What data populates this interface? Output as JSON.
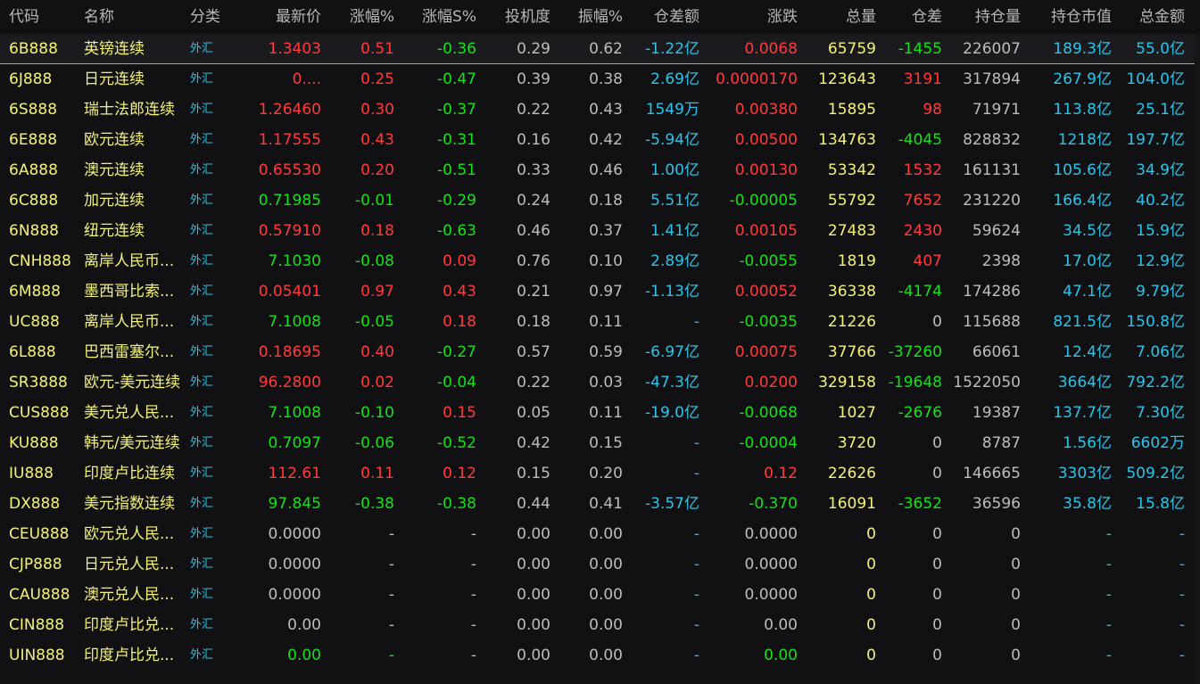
{
  "headers": [
    "代码",
    "名称",
    "分类",
    "最新价",
    "涨幅%",
    "涨幅S%",
    "投机度",
    "振幅%",
    "仓差额",
    "涨跌",
    "总量",
    "仓差",
    "持仓量",
    "持仓市值",
    "总金额"
  ],
  "colors": {
    "red": "#ff3b3b",
    "green": "#17e01a",
    "gray": "#bdbdbd",
    "cyan": "#2ec3e6",
    "yellow": "#f3f27a"
  },
  "rows": [
    {
      "code": "6B888",
      "name": "英镑连续",
      "cat": "外汇",
      "price": "1.3403",
      "chg": "0.51",
      "chgs": "-0.36",
      "spec": "0.29",
      "amp": "0.62",
      "oiamt": "-1.22亿",
      "diff": "0.0068",
      "vol": "65759",
      "oi": "-1455",
      "hold": "226007",
      "holdval": "189.3亿",
      "amount": "55.0亿",
      "c": {
        "price": "red",
        "chg": "red",
        "chgs": "green",
        "diff": "red",
        "oi": "green"
      }
    },
    {
      "code": "6J888",
      "name": "日元连续",
      "cat": "外汇",
      "price": "0....",
      "chg": "0.25",
      "chgs": "-0.47",
      "spec": "0.39",
      "amp": "0.38",
      "oiamt": "2.69亿",
      "diff": "0.0000170",
      "vol": "123643",
      "oi": "3191",
      "hold": "317894",
      "holdval": "267.9亿",
      "amount": "104.0亿",
      "c": {
        "price": "red",
        "chg": "red",
        "chgs": "green",
        "diff": "red",
        "oi": "red"
      }
    },
    {
      "code": "6S888",
      "name": "瑞士法郎连续",
      "cat": "外汇",
      "price": "1.26460",
      "chg": "0.30",
      "chgs": "-0.37",
      "spec": "0.22",
      "amp": "0.43",
      "oiamt": "1549万",
      "diff": "0.00380",
      "vol": "15895",
      "oi": "98",
      "hold": "71971",
      "holdval": "113.8亿",
      "amount": "25.1亿",
      "c": {
        "price": "red",
        "chg": "red",
        "chgs": "green",
        "diff": "red",
        "oi": "red"
      }
    },
    {
      "code": "6E888",
      "name": "欧元连续",
      "cat": "外汇",
      "price": "1.17555",
      "chg": "0.43",
      "chgs": "-0.31",
      "spec": "0.16",
      "amp": "0.42",
      "oiamt": "-5.94亿",
      "diff": "0.00500",
      "vol": "134763",
      "oi": "-4045",
      "hold": "828832",
      "holdval": "1218亿",
      "amount": "197.7亿",
      "c": {
        "price": "red",
        "chg": "red",
        "chgs": "green",
        "diff": "red",
        "oi": "green"
      }
    },
    {
      "code": "6A888",
      "name": "澳元连续",
      "cat": "外汇",
      "price": "0.65530",
      "chg": "0.20",
      "chgs": "-0.51",
      "spec": "0.33",
      "amp": "0.46",
      "oiamt": "1.00亿",
      "diff": "0.00130",
      "vol": "53342",
      "oi": "1532",
      "hold": "161131",
      "holdval": "105.6亿",
      "amount": "34.9亿",
      "c": {
        "price": "red",
        "chg": "red",
        "chgs": "green",
        "diff": "red",
        "oi": "red"
      }
    },
    {
      "code": "6C888",
      "name": "加元连续",
      "cat": "外汇",
      "price": "0.71985",
      "chg": "-0.01",
      "chgs": "-0.29",
      "spec": "0.24",
      "amp": "0.18",
      "oiamt": "5.51亿",
      "diff": "-0.00005",
      "vol": "55792",
      "oi": "7652",
      "hold": "231220",
      "holdval": "166.4亿",
      "amount": "40.2亿",
      "c": {
        "price": "green",
        "chg": "green",
        "chgs": "green",
        "diff": "green",
        "oi": "red"
      }
    },
    {
      "code": "6N888",
      "name": "纽元连续",
      "cat": "外汇",
      "price": "0.57910",
      "chg": "0.18",
      "chgs": "-0.63",
      "spec": "0.46",
      "amp": "0.37",
      "oiamt": "1.41亿",
      "diff": "0.00105",
      "vol": "27483",
      "oi": "2430",
      "hold": "59624",
      "holdval": "34.5亿",
      "amount": "15.9亿",
      "c": {
        "price": "red",
        "chg": "red",
        "chgs": "green",
        "diff": "red",
        "oi": "red"
      }
    },
    {
      "code": "CNH888",
      "name": "离岸人民币...",
      "cat": "外汇",
      "price": "7.1030",
      "chg": "-0.08",
      "chgs": "0.09",
      "spec": "0.76",
      "amp": "0.10",
      "oiamt": "2.89亿",
      "diff": "-0.0055",
      "vol": "1819",
      "oi": "407",
      "hold": "2398",
      "holdval": "17.0亿",
      "amount": "12.9亿",
      "c": {
        "price": "green",
        "chg": "green",
        "chgs": "red",
        "diff": "green",
        "oi": "red"
      }
    },
    {
      "code": "6M888",
      "name": "墨西哥比索...",
      "cat": "外汇",
      "price": "0.05401",
      "chg": "0.97",
      "chgs": "0.43",
      "spec": "0.21",
      "amp": "0.97",
      "oiamt": "-1.13亿",
      "diff": "0.00052",
      "vol": "36338",
      "oi": "-4174",
      "hold": "174286",
      "holdval": "47.1亿",
      "amount": "9.79亿",
      "c": {
        "price": "red",
        "chg": "red",
        "chgs": "red",
        "diff": "red",
        "oi": "green"
      }
    },
    {
      "code": "UC888",
      "name": "离岸人民币...",
      "cat": "外汇",
      "price": "7.1008",
      "chg": "-0.05",
      "chgs": "0.18",
      "spec": "0.18",
      "amp": "0.11",
      "oiamt": "-",
      "diff": "-0.0035",
      "vol": "21226",
      "oi": "0",
      "hold": "115688",
      "holdval": "821.5亿",
      "amount": "150.8亿",
      "c": {
        "price": "green",
        "chg": "green",
        "chgs": "red",
        "diff": "green",
        "oi": "gray"
      }
    },
    {
      "code": "6L888",
      "name": "巴西雷塞尔...",
      "cat": "外汇",
      "price": "0.18695",
      "chg": "0.40",
      "chgs": "-0.27",
      "spec": "0.57",
      "amp": "0.59",
      "oiamt": "-6.97亿",
      "diff": "0.00075",
      "vol": "37766",
      "oi": "-37260",
      "hold": "66061",
      "holdval": "12.4亿",
      "amount": "7.06亿",
      "c": {
        "price": "red",
        "chg": "red",
        "chgs": "green",
        "diff": "red",
        "oi": "green"
      }
    },
    {
      "code": "SR3888",
      "name": "欧元-美元连续",
      "cat": "外汇",
      "price": "96.2800",
      "chg": "0.02",
      "chgs": "-0.04",
      "spec": "0.22",
      "amp": "0.03",
      "oiamt": "-47.3亿",
      "diff": "0.0200",
      "vol": "329158",
      "oi": "-19648",
      "hold": "1522050",
      "holdval": "3664亿",
      "amount": "792.2亿",
      "c": {
        "price": "red",
        "chg": "red",
        "chgs": "green",
        "diff": "red",
        "oi": "green"
      }
    },
    {
      "code": "CUS888",
      "name": "美元兑人民...",
      "cat": "外汇",
      "price": "7.1008",
      "chg": "-0.10",
      "chgs": "0.15",
      "spec": "0.05",
      "amp": "0.11",
      "oiamt": "-19.0亿",
      "diff": "-0.0068",
      "vol": "1027",
      "oi": "-2676",
      "hold": "19387",
      "holdval": "137.7亿",
      "amount": "7.30亿",
      "c": {
        "price": "green",
        "chg": "green",
        "chgs": "red",
        "diff": "green",
        "oi": "green"
      }
    },
    {
      "code": "KU888",
      "name": "韩元/美元连续",
      "cat": "外汇",
      "price": "0.7097",
      "chg": "-0.06",
      "chgs": "-0.52",
      "spec": "0.42",
      "amp": "0.15",
      "oiamt": "-",
      "diff": "-0.0004",
      "vol": "3720",
      "oi": "0",
      "hold": "8787",
      "holdval": "1.56亿",
      "amount": "6602万",
      "c": {
        "price": "green",
        "chg": "green",
        "chgs": "green",
        "diff": "green",
        "oi": "gray"
      }
    },
    {
      "code": "IU888",
      "name": "印度卢比连续",
      "cat": "外汇",
      "price": "112.61",
      "chg": "0.11",
      "chgs": "0.12",
      "spec": "0.15",
      "amp": "0.20",
      "oiamt": "-",
      "diff": "0.12",
      "vol": "22626",
      "oi": "0",
      "hold": "146665",
      "holdval": "3303亿",
      "amount": "509.2亿",
      "c": {
        "price": "red",
        "chg": "red",
        "chgs": "red",
        "diff": "red",
        "oi": "gray"
      }
    },
    {
      "code": "DX888",
      "name": "美元指数连续",
      "cat": "外汇",
      "price": "97.845",
      "chg": "-0.38",
      "chgs": "-0.38",
      "spec": "0.44",
      "amp": "0.41",
      "oiamt": "-3.57亿",
      "diff": "-0.370",
      "vol": "16091",
      "oi": "-3652",
      "hold": "36596",
      "holdval": "35.8亿",
      "amount": "15.8亿",
      "c": {
        "price": "green",
        "chg": "green",
        "chgs": "green",
        "diff": "green",
        "oi": "green"
      }
    },
    {
      "code": "CEU888",
      "name": "欧元兑人民...",
      "cat": "外汇",
      "price": "0.0000",
      "chg": "-",
      "chgs": "-",
      "spec": "0.00",
      "amp": "0.00",
      "oiamt": "-",
      "diff": "0.0000",
      "vol": "0",
      "oi": "0",
      "hold": "0",
      "holdval": "-",
      "amount": "-",
      "c": {
        "price": "gray",
        "chg": "gray",
        "chgs": "gray",
        "diff": "gray",
        "oi": "gray"
      }
    },
    {
      "code": "CJP888",
      "name": "日元兑人民...",
      "cat": "外汇",
      "price": "0.0000",
      "chg": "-",
      "chgs": "-",
      "spec": "0.00",
      "amp": "0.00",
      "oiamt": "-",
      "diff": "0.0000",
      "vol": "0",
      "oi": "0",
      "hold": "0",
      "holdval": "-",
      "amount": "-",
      "c": {
        "price": "gray",
        "chg": "gray",
        "chgs": "gray",
        "diff": "gray",
        "oi": "gray"
      }
    },
    {
      "code": "CAU888",
      "name": "澳元兑人民...",
      "cat": "外汇",
      "price": "0.0000",
      "chg": "-",
      "chgs": "-",
      "spec": "0.00",
      "amp": "0.00",
      "oiamt": "-",
      "diff": "0.0000",
      "vol": "0",
      "oi": "0",
      "hold": "0",
      "holdval": "-",
      "amount": "-",
      "c": {
        "price": "gray",
        "chg": "gray",
        "chgs": "gray",
        "diff": "gray",
        "oi": "gray"
      }
    },
    {
      "code": "CIN888",
      "name": "印度卢比兑...",
      "cat": "外汇",
      "price": "0.00",
      "chg": "-",
      "chgs": "-",
      "spec": "0.00",
      "amp": "0.00",
      "oiamt": "-",
      "diff": "0.00",
      "vol": "0",
      "oi": "0",
      "hold": "0",
      "holdval": "-",
      "amount": "-",
      "c": {
        "price": "gray",
        "chg": "gray",
        "chgs": "gray",
        "diff": "gray",
        "oi": "gray"
      }
    },
    {
      "code": "UIN888",
      "name": "印度卢比兑...",
      "cat": "外汇",
      "price": "0.00",
      "chg": "-",
      "chgs": "-",
      "spec": "0.00",
      "amp": "0.00",
      "oiamt": "-",
      "diff": "0.00",
      "vol": "0",
      "oi": "0",
      "hold": "0",
      "holdval": "-",
      "amount": "-",
      "c": {
        "price": "green",
        "chg": "green",
        "chgs": "gray",
        "diff": "green",
        "oi": "gray"
      }
    }
  ]
}
